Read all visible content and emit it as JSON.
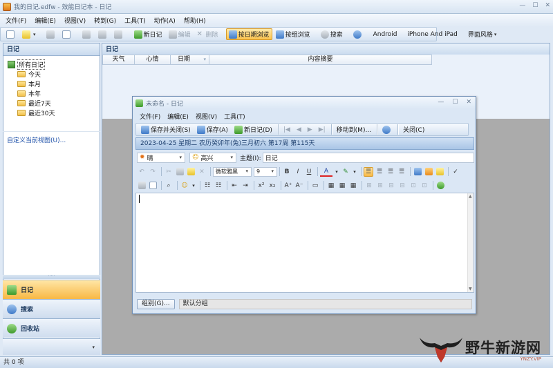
{
  "app": {
    "title": "我的日记.edfw - 效能日记本 - 日记",
    "menu": [
      "文件(F)",
      "编辑(E)",
      "视图(V)",
      "转到(G)",
      "工具(T)",
      "动作(A)",
      "帮助(H)"
    ],
    "toolbar": {
      "new_diary": "新日记",
      "edit": "编辑",
      "delete": "删除",
      "by_date": "按日期浏览",
      "by_group": "按组浏览",
      "search": "搜索",
      "android": "Android",
      "iphone": "iPhone And iPad",
      "skin": "界面风格"
    }
  },
  "left_pane": {
    "header": "日记",
    "tree": {
      "root": "所有日记",
      "items": [
        "今天",
        "本月",
        "本年",
        "最近7天",
        "最近30天"
      ]
    },
    "custom_view": "自定义当前视图(U)...",
    "nav": {
      "diary": "日记",
      "search": "搜索",
      "recycle": "回收站"
    }
  },
  "right_pane": {
    "header": "日记",
    "columns": [
      "天气",
      "心情",
      "日期",
      "内容摘要"
    ]
  },
  "status": "共 0 项",
  "dialog": {
    "title": "未命名 - 日记",
    "menu": [
      "文件(F)",
      "编辑(E)",
      "视图(V)",
      "工具(T)"
    ],
    "toolbar": {
      "save_close": "保存并关闭(S)",
      "save": "保存(A)",
      "new_diary": "新日记(D)",
      "move_to": "移动到(M)...",
      "close": "关闭(C)"
    },
    "date_line": "2023-04-25 星期二 农历癸卯年(兔)三月初六  第17周 第115天",
    "weather": "晴",
    "mood": "高兴",
    "subject_label": "主题(I):",
    "subject_value": "日记",
    "font_name": "微软雅黑",
    "font_size": "9",
    "bold": "B",
    "italic": "I",
    "underline": "U",
    "group_button": "组别(G)...",
    "group_value": "默认分组"
  },
  "watermark": {
    "main": "野牛新游网",
    "sub": "YNZY.VIP"
  }
}
